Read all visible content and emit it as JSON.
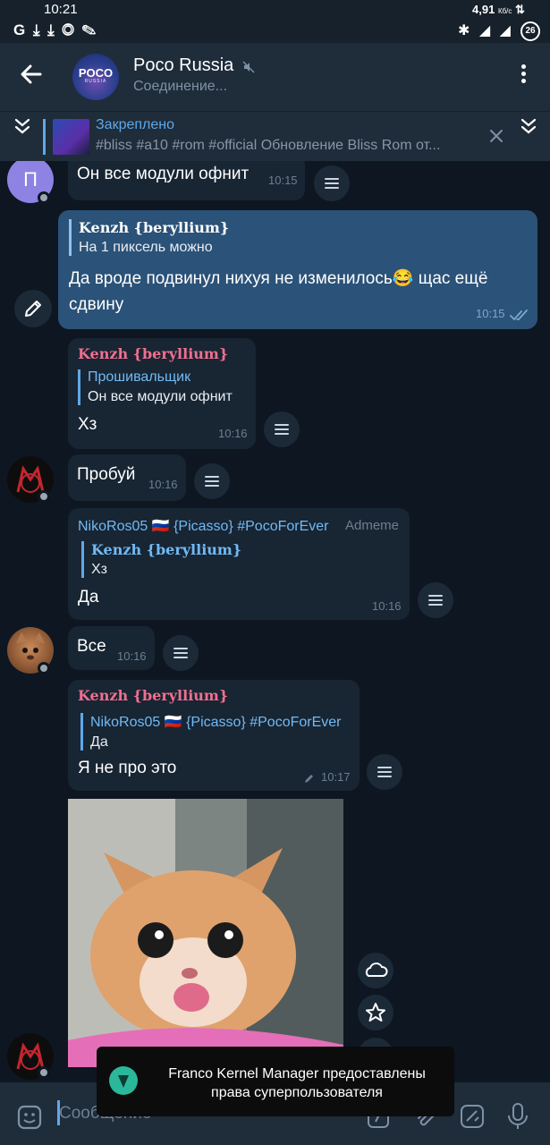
{
  "statusbar": {
    "time": "10:21",
    "speed": "4,91",
    "speed_unit": "Кб/с",
    "left_icons": "G ⤓ ⤓ ◎ ✎",
    "right_icons": "✱ ◢ ◢",
    "battery": "26"
  },
  "header": {
    "title": "Poco Russia",
    "status": "Соединение...",
    "avatar_text": "POCO",
    "avatar_subtext": "RUSSIA"
  },
  "pinned": {
    "title": "Закреплено",
    "text": "#bliss #a10 #rom #official Обновление Bliss Rom от..."
  },
  "messages": [
    {
      "text": "Он все модули офнит",
      "time": "10:15",
      "avatar_letter": "П"
    },
    {
      "reply_name": "Kenzh {beryllium}",
      "reply_text": "На 1 пиксель можно",
      "text_line1": "Да вроде подвинул нихуя не изменилось😂 щас ещё",
      "text_line2": "сдвину",
      "time": "10:15"
    },
    {
      "sender": "Kenzh {beryllium}",
      "reply_name": "Прошивальщик",
      "reply_text": "Он все модули офнит",
      "text": "Хз",
      "time": "10:16"
    },
    {
      "text": "Пробуй",
      "time": "10:16"
    },
    {
      "sender": "NikoRos05 🇷🇺 {Picasso} #PocoForEver",
      "tag": "Admeme",
      "reply_name": "Kenzh {beryllium}",
      "reply_text": "Хз",
      "text": "Да",
      "time": "10:16"
    },
    {
      "text": "Все",
      "time": "10:16"
    },
    {
      "sender": "Kenzh {beryllium}",
      "reply_name": "NikoRos05 🇷🇺 {Picasso} #PocoForEver",
      "reply_text": "Да",
      "text": "Я не про это",
      "time": "10:17"
    }
  ],
  "input": {
    "placeholder": "Сообщение"
  },
  "toast": {
    "line1": "Franco Kernel Manager предоставлены",
    "line2": "права суперпользователя"
  },
  "colors": {
    "accent": "#5fa8e8",
    "pink_name": "#f06f8f",
    "bg": "#0e1621",
    "bubble_in": "#182533",
    "bubble_out": "#2b5278"
  }
}
